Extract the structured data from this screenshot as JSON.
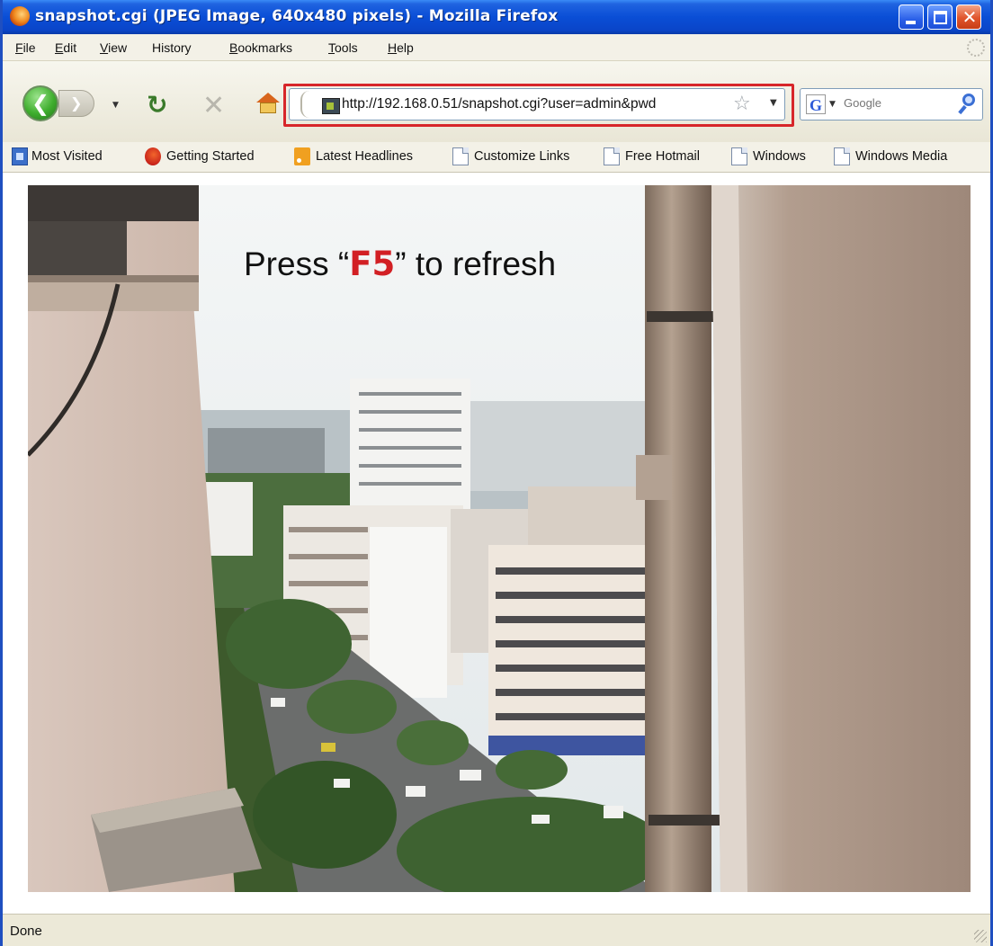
{
  "window": {
    "title": "snapshot.cgi (JPEG Image, 640x480 pixels) - Mozilla Firefox",
    "icon": "firefox-icon",
    "controls": [
      "minimize-icon",
      "maximize-icon",
      "close-icon"
    ]
  },
  "menubar": {
    "items": [
      {
        "label": "File",
        "accel": "F",
        "rest": "ile"
      },
      {
        "label": "Edit",
        "accel": "E",
        "rest": "dit"
      },
      {
        "label": "View",
        "accel": "V",
        "rest": "iew"
      },
      {
        "label": "History",
        "accel": "",
        "rest": "History"
      },
      {
        "label": "Bookmarks",
        "accel": "B",
        "rest": "ookmarks"
      },
      {
        "label": "Tools",
        "accel": "T",
        "rest": "ools"
      },
      {
        "label": "Help",
        "accel": "H",
        "rest": "elp"
      }
    ]
  },
  "navbar": {
    "url": "http://192.168.0.51/snapshot.cgi?user=admin&pwd",
    "search_placeholder": "Google",
    "search_engine_icon": "G"
  },
  "bookmarks": {
    "items": [
      {
        "label": "Most Visited",
        "icon": "most-visited-icon"
      },
      {
        "label": "Getting Started",
        "icon": "firefox-bookmark-icon"
      },
      {
        "label": "Latest Headlines",
        "icon": "rss-feed-icon"
      },
      {
        "label": "Customize Links",
        "icon": "page-icon"
      },
      {
        "label": "Free Hotmail",
        "icon": "page-icon"
      },
      {
        "label": "Windows",
        "icon": "page-icon"
      },
      {
        "label": "Windows Media",
        "icon": "page-icon"
      }
    ]
  },
  "content": {
    "caption_before": "Press “",
    "caption_key": "F5",
    "caption_after": "” to refresh"
  },
  "status": {
    "text": "Done"
  },
  "colors": {
    "titlebar": "#0a4ed6",
    "highlight": "#d7262a",
    "key_text": "#d21f24"
  }
}
